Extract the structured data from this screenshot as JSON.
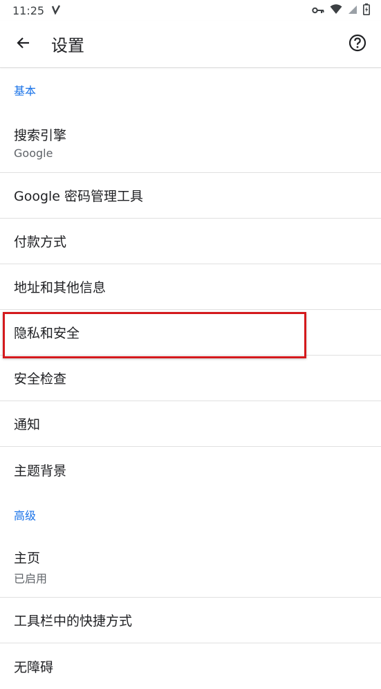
{
  "status": {
    "time": "11:25"
  },
  "appbar": {
    "title": "设置"
  },
  "sections": {
    "basic": {
      "header": "基本",
      "search_engine": {
        "title": "搜索引擎",
        "subtitle": "Google"
      },
      "password_manager": "Google 密码管理工具",
      "payment_methods": "付款方式",
      "addresses": "地址和其他信息",
      "privacy_security": "隐私和安全",
      "safety_check": "安全检查",
      "notifications": "通知",
      "themes": "主题背景"
    },
    "advanced": {
      "header": "高级",
      "homepage": {
        "title": "主页",
        "subtitle": "已启用"
      },
      "toolbar_shortcut": "工具栏中的快捷方式",
      "accessibility": "无障碍"
    }
  },
  "colors": {
    "accent": "#1a73e8",
    "highlight": "#d4191c"
  }
}
